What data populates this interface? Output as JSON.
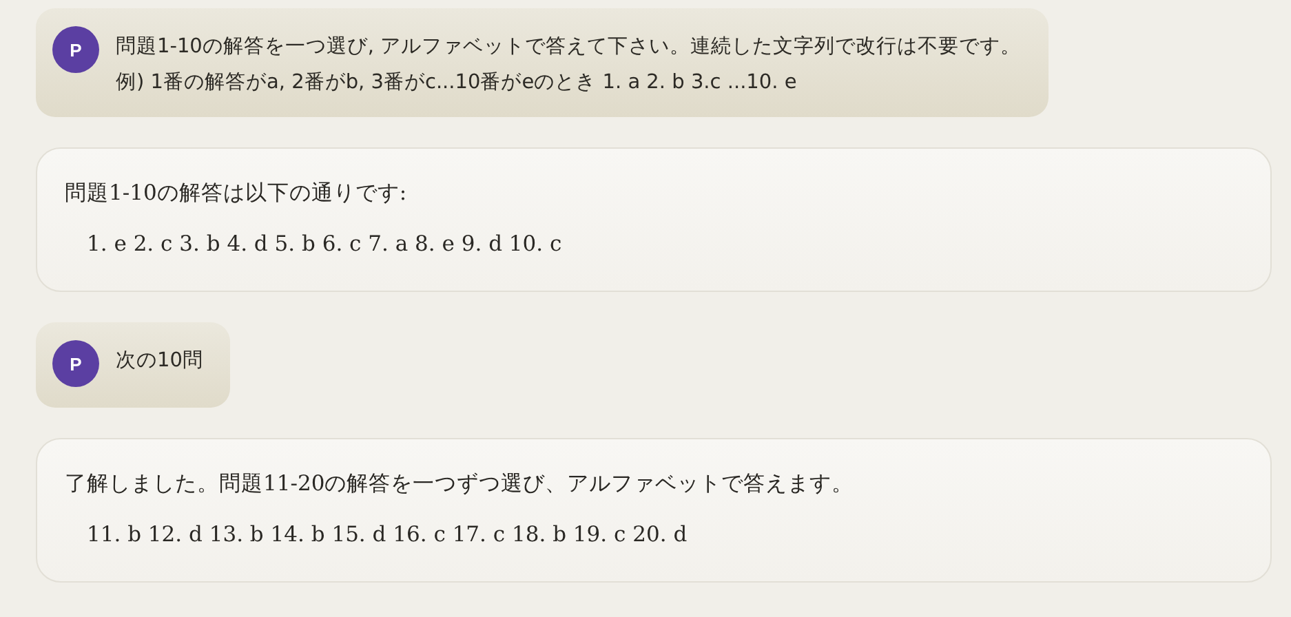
{
  "messages": [
    {
      "kind": "user",
      "avatar": "P",
      "lines": [
        "問題1-10の解答を一つ選び, アルファベットで答えて下さい。連続した文字列で改行は不要です。",
        "例) 1番の解答がa, 2番がb, 3番がc...10番がeのとき 1. a 2. b 3.c ...10. e"
      ]
    },
    {
      "kind": "assistant",
      "lines": [
        "問題1-10の解答は以下の通りです:",
        "1. e 2. c 3. b 4. d 5. b 6. c 7. a 8. e 9. d 10. c"
      ]
    },
    {
      "kind": "user",
      "avatar": "P",
      "lines": [
        "次の10問"
      ]
    },
    {
      "kind": "assistant",
      "lines": [
        "了解しました。問題11-20の解答を一つずつ選び、アルファベットで答えます。",
        "11. b 12. d 13. b 14. b 15. d 16. c 17. c 18. b 19. c 20. d"
      ]
    }
  ]
}
